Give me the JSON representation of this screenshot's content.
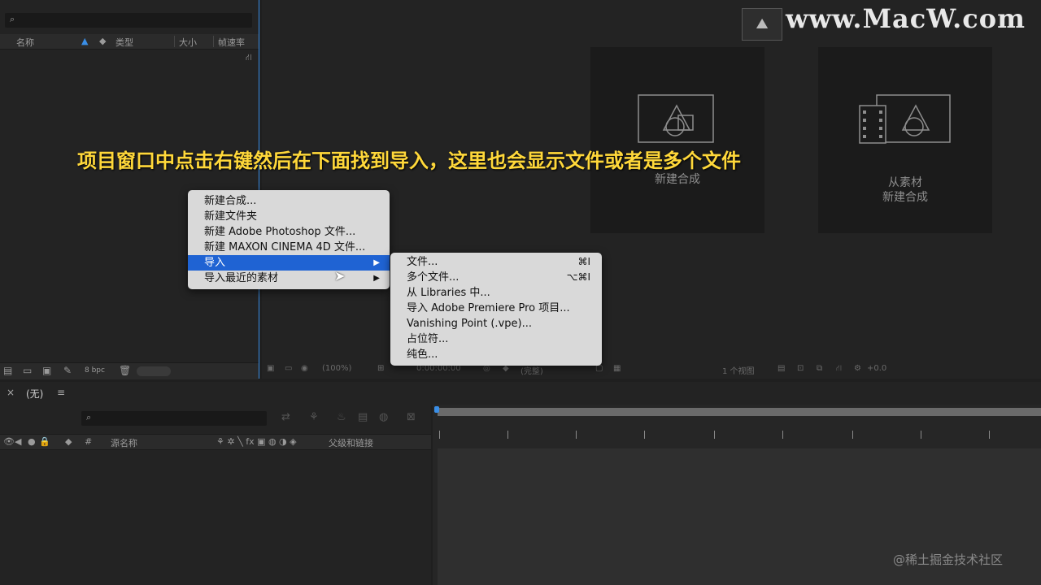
{
  "watermark": {
    "site": "www.MacW.com",
    "logo_glyph": "⛰",
    "community": "@稀土掘金技术社区"
  },
  "subtitle": "项目窗口中点击右键然后在下面找到导入，这里也会显示文件或者是多个文件",
  "project_panel": {
    "search_icon": "search-icon",
    "columns": [
      "名称",
      "类型",
      "大小",
      "帧速率"
    ],
    "footer": {
      "bpc": "8 bpc"
    }
  },
  "comp_panel": {
    "new_comp_caption": "新建合成",
    "from_footage_line1": "从素材",
    "from_footage_line2": "新建合成",
    "toolbar": {
      "zoom": "(100%)",
      "timecode": "0:00:00:00",
      "quality": "(完整)",
      "views": "1 个视图",
      "offset": "+0.0"
    }
  },
  "context_menu": {
    "items": [
      "新建合成...",
      "新建文件夹",
      "新建 Adobe Photoshop 文件...",
      "新建 MAXON CINEMA 4D 文件...",
      "导入",
      "导入最近的素材"
    ],
    "highlighted_index": 4
  },
  "import_submenu": {
    "items": [
      {
        "label": "文件...",
        "shortcut": "⌘I"
      },
      {
        "label": "多个文件...",
        "shortcut": "⌥⌘I"
      },
      {
        "label": "从 Libraries 中...",
        "shortcut": ""
      },
      {
        "label": "导入 Adobe Premiere Pro 项目...",
        "shortcut": ""
      },
      {
        "label": "Vanishing Point (.vpe)...",
        "shortcut": ""
      },
      {
        "label": "占位符...",
        "shortcut": ""
      },
      {
        "label": "纯色...",
        "shortcut": ""
      }
    ]
  },
  "timeline": {
    "tab_close": "×",
    "tab_label": "(无)",
    "tab_menu": "≡",
    "columns": {
      "hash": "#",
      "source_name": "源名称",
      "parent": "父级和链接"
    }
  }
}
